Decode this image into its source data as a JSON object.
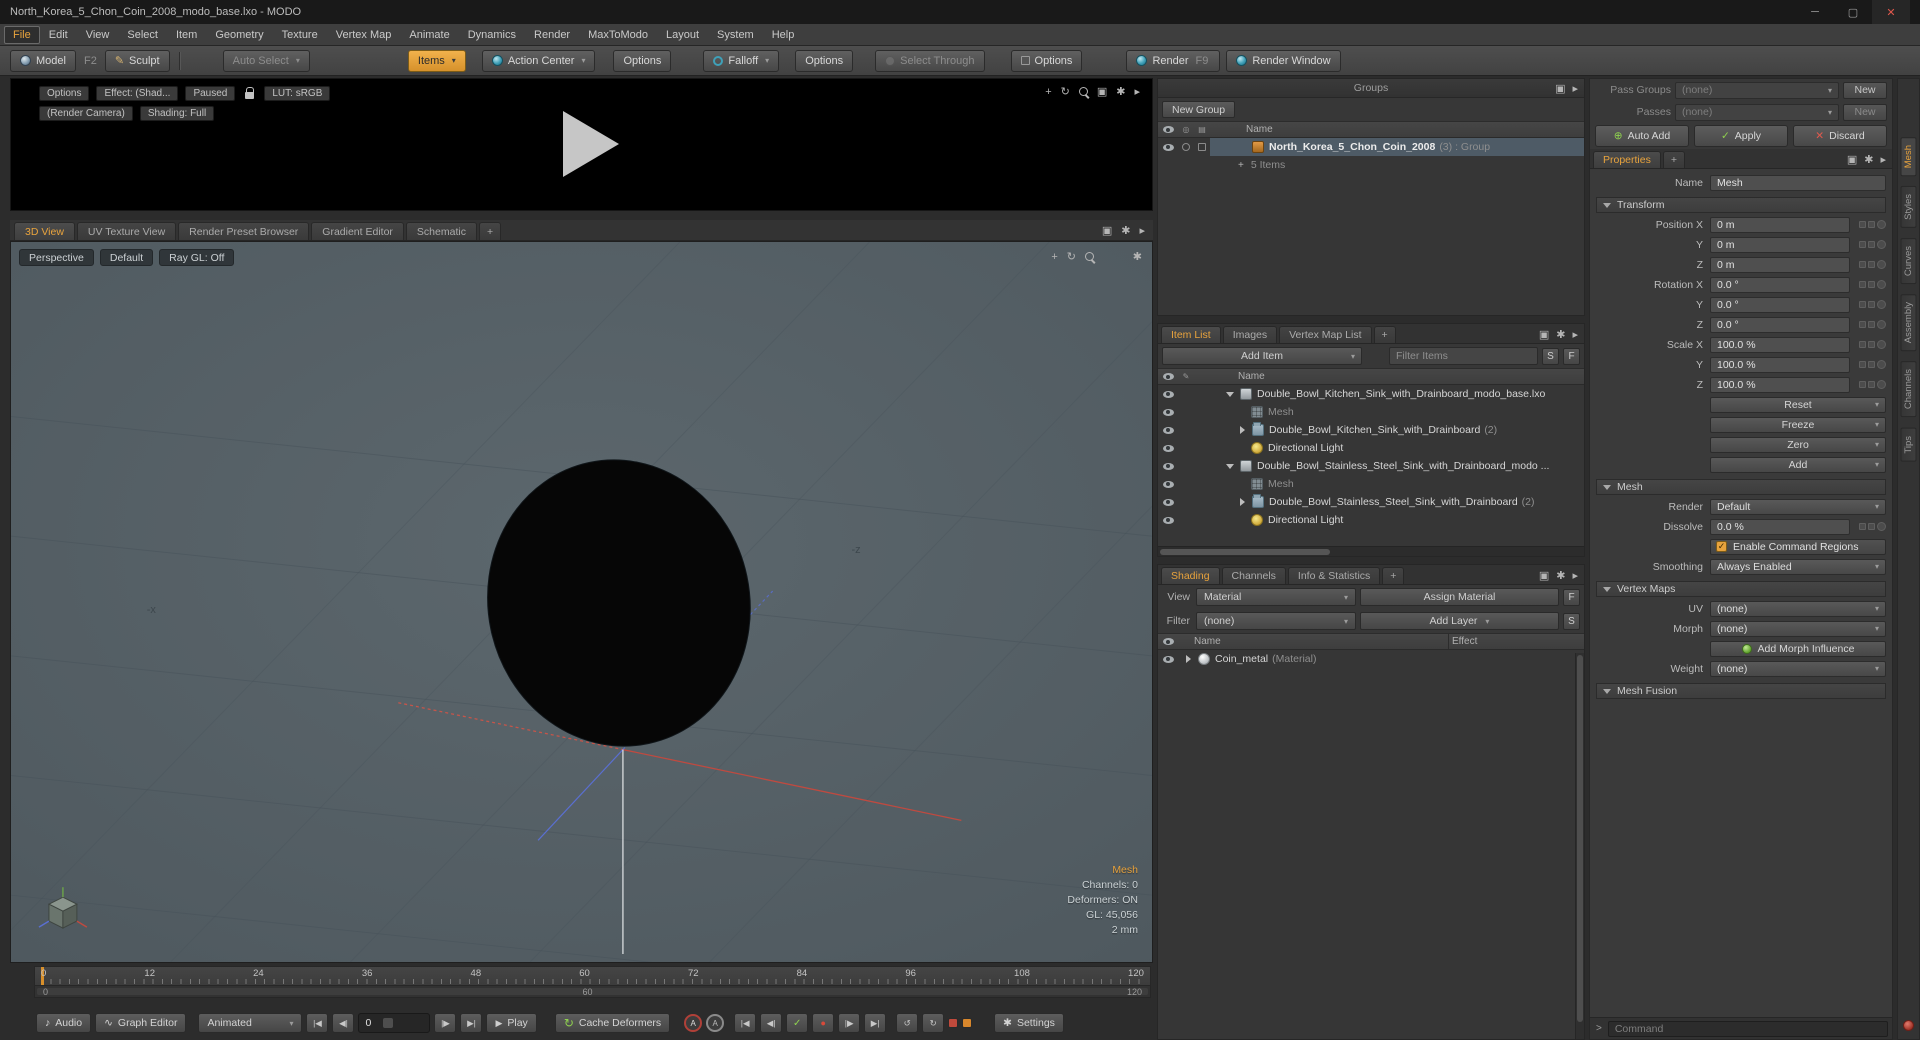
{
  "window": {
    "title": "North_Korea_5_Chon_Coin_2008_modo_base.lxo - MODO"
  },
  "icons": {
    "minimize": "─",
    "restore": "▢",
    "close": "✕",
    "caret": "▾",
    "flyout": "▸",
    "maximize": "▣",
    "gear": "✱",
    "pan": "+",
    "rotate": "↻",
    "loop": "↺",
    "play": "▶",
    "check": "✓",
    "record": "●",
    "tostart": "|◀",
    "prevframe": "◀|",
    "nextframe": "|▶",
    "toend": "▶|",
    "note": "♪",
    "wave": "∿",
    "pen": "✎",
    "plus": "+",
    "letter_a": "A",
    "prompt": ">",
    "plus_circle": "⊕",
    "circle_col": "◎",
    "square_col": "▤"
  },
  "menubar": {
    "items": [
      "File",
      "Edit",
      "View",
      "Select",
      "Item",
      "Geometry",
      "Texture",
      "Vertex Map",
      "Animate",
      "Dynamics",
      "Render",
      "MaxToModo",
      "Layout",
      "System",
      "Help"
    ]
  },
  "toolbar": {
    "model": "Model",
    "model_key": "F2",
    "sculpt": "Sculpt",
    "auto_select": "Auto Select",
    "items": "Items",
    "action_center": "Action Center",
    "options_a": "Options",
    "falloff": "Falloff",
    "options_b": "Options",
    "select_through": "Select Through",
    "options_c": "Options",
    "render": "Render",
    "render_key": "F9",
    "render_window": "Render Window"
  },
  "preview": {
    "options": "Options",
    "effect": "Effect: (Shad...",
    "paused": "Paused",
    "lut": "LUT: sRGB",
    "camera": "(Render Camera)",
    "shading": "Shading: Full"
  },
  "viewport": {
    "tabs": [
      "3D View",
      "UV Texture View",
      "Render Preset Browser",
      "Gradient Editor",
      "Schematic"
    ],
    "projection": "Perspective",
    "style": "Default",
    "raygl": "Ray GL: Off",
    "axis_x": "-x",
    "axis_z": "-z",
    "info": [
      "Mesh",
      "Channels: 0",
      "Deformers: ON",
      "GL: 45,056",
      "2 mm"
    ]
  },
  "timeline": {
    "ticks": [
      "0",
      "12",
      "24",
      "36",
      "48",
      "60",
      "72",
      "84",
      "96",
      "108",
      "120"
    ],
    "range_start": "0",
    "range_mid": "60",
    "range_end": "120"
  },
  "transport": {
    "audio": "Audio",
    "graph_editor": "Graph Editor",
    "mode": "Animated",
    "frame": "0",
    "play": "Play",
    "cache": "Cache Deformers",
    "settings": "Settings"
  },
  "groups": {
    "title": "Groups",
    "new_group": "New Group",
    "name_col": "Name",
    "group_name": "North_Korea_5_Chon_Coin_2008",
    "group_suffix": "(3) : Group",
    "child_count": "5 Items"
  },
  "item_list": {
    "tabs": [
      "Item List",
      "Images",
      "Vertex Map List"
    ],
    "add_item": "Add Item",
    "filter_placeholder": "Filter Items",
    "s": "S",
    "f": "F",
    "name_col": "Name",
    "rows": [
      {
        "label": "Double_Bowl_Kitchen_Sink_with_Drainboard_modo_base.lxo",
        "suffix": ""
      },
      {
        "label": "Mesh",
        "suffix": ""
      },
      {
        "label": "Double_Bowl_Kitchen_Sink_with_Drainboard",
        "suffix": "(2)"
      },
      {
        "label": "Directional Light",
        "suffix": ""
      },
      {
        "label": "Double_Bowl_Stainless_Steel_Sink_with_Drainboard_modo ...",
        "suffix": ""
      },
      {
        "label": "Mesh",
        "suffix": ""
      },
      {
        "label": "Double_Bowl_Stainless_Steel_Sink_with_Drainboard",
        "suffix": "(2)"
      },
      {
        "label": "Directional Light",
        "suffix": ""
      }
    ]
  },
  "shading": {
    "tabs": [
      "Shading",
      "Channels",
      "Info & Statistics"
    ],
    "view_label": "View",
    "view_value": "Material",
    "assign_button": "Assign Material",
    "f": "F",
    "filter_label": "Filter",
    "filter_value": "(none)",
    "add_layer": "Add Layer",
    "s": "S",
    "name_col": "Name",
    "effect_col": "Effect",
    "material_name": "Coin_metal",
    "material_suffix": "(Material)"
  },
  "properties": {
    "pass_groups_label": "Pass Groups",
    "pass_groups_value": "(none)",
    "pass_groups_new": "New",
    "passes_label": "Passes",
    "passes_value": "(none)",
    "passes_new": "New",
    "auto_add": "Auto Add",
    "apply": "Apply",
    "discard": "Discard",
    "tab": "Properties",
    "name_label": "Name",
    "name_value": "Mesh",
    "transform": {
      "title": "Transform",
      "rows": [
        {
          "label": "Position X",
          "value": "0 m"
        },
        {
          "label": "Y",
          "value": "0 m"
        },
        {
          "label": "Z",
          "value": "0 m"
        },
        {
          "label": "Rotation X",
          "value": "0.0 °"
        },
        {
          "label": "Y",
          "value": "0.0 °"
        },
        {
          "label": "Z",
          "value": "0.0 °"
        },
        {
          "label": "Scale X",
          "value": "100.0 %"
        },
        {
          "label": "Y",
          "value": "100.0 %"
        },
        {
          "label": "Z",
          "value": "100.0 %"
        }
      ],
      "buttons": [
        "Reset",
        "Freeze",
        "Zero",
        "Add"
      ]
    },
    "mesh": {
      "title": "Mesh",
      "render_label": "Render",
      "render_value": "Default",
      "dissolve_label": "Dissolve",
      "dissolve_value": "0.0 %",
      "enable_regions": "Enable Command Regions",
      "smoothing_label": "Smoothing",
      "smoothing_value": "Always Enabled"
    },
    "vertex_maps": {
      "title": "Vertex Maps",
      "uv_label": "UV",
      "uv_value": "(none)",
      "morph_label": "Morph",
      "morph_value": "(none)",
      "add_morph": "Add Morph Influence",
      "weight_label": "Weight",
      "weight_value": "(none)"
    },
    "mesh_fusion": {
      "title": "Mesh Fusion"
    },
    "command_placeholder": "Command"
  },
  "side_tabs": {
    "items": [
      "Mesh",
      "Styles",
      "Curves",
      "Assembly",
      "Channels",
      "Tips"
    ]
  },
  "colors": {
    "accent": "#e8a33d",
    "selection": "#4e5b66",
    "viewport_bg": "#57626a",
    "green": "#7ac142",
    "red": "#c0453c"
  }
}
